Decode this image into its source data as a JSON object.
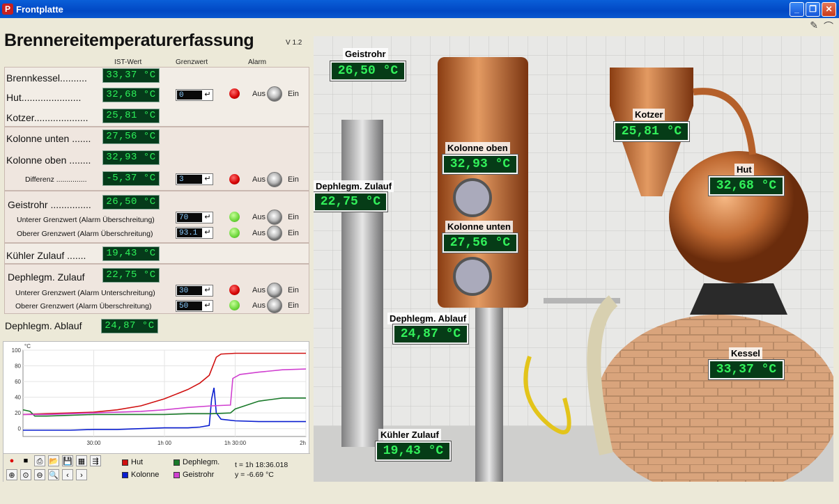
{
  "window": {
    "title": "Frontplatte",
    "app_icon": "app-logo-icon"
  },
  "header": {
    "title": "Brennereitemperaturerfassung",
    "version": "V 1.2"
  },
  "columns": {
    "ist": "IST-Wert",
    "grenz": "Grenzwert",
    "alarm": "Alarm"
  },
  "rows": {
    "brennkessel": {
      "label": "Brennkessel..........",
      "value": "33,37 °C"
    },
    "hut": {
      "label": "Hut......................",
      "value": "32,68 °C",
      "limit": "0",
      "led": "red",
      "off": "Aus",
      "on": "Ein"
    },
    "kotzer": {
      "label": "Kotzer....................",
      "value": "25,81 °C"
    },
    "kolonne_unten": {
      "label": "Kolonne unten .......",
      "value": "27,56 °C"
    },
    "kolonne_oben": {
      "label": "Kolonne oben ........",
      "value": "32,93 °C"
    },
    "differenz": {
      "label": "Differenz ...............",
      "value": "-5,37 °C",
      "limit": "3",
      "led": "red",
      "off": "Aus",
      "on": "Ein"
    },
    "geistrohr": {
      "label": "Geistrohr ...............",
      "value": "26,50 °C"
    },
    "geist_unten": {
      "label": "Unterer Grenzwert (Alarm Überschreitung)",
      "limit": "70",
      "led": "green",
      "off": "Aus",
      "on": "Ein"
    },
    "geist_oben": {
      "label": "Oberer Grenzwert (Alarm Überschreitung)",
      "limit": "93.1",
      "led": "green",
      "off": "Aus",
      "on": "Ein"
    },
    "kuehler": {
      "label": "Kühler Zulauf .......",
      "value": "19,43 °C"
    },
    "dephl_zulauf": {
      "label": "Dephlegm. Zulauf",
      "value": "22,75 °C"
    },
    "dephl_unten": {
      "label": "Unterer Grenzwert (Alarm Unterschreitung)",
      "limit": "30",
      "led": "red",
      "off": "Aus",
      "on": "Ein"
    },
    "dephl_oben": {
      "label": "Oberer Grenzwert (Alarm Überschreitung)",
      "limit": "50",
      "led": "green",
      "off": "Aus",
      "on": "Ein"
    },
    "dephl_ablauf": {
      "label": "Dephlegm. Ablauf",
      "value": "24,87 °C"
    }
  },
  "chart_data": {
    "type": "line",
    "ylabel": "°C",
    "ylim": [
      -10,
      100
    ],
    "yticks": [
      "100",
      "80",
      "60",
      "40",
      "20",
      "0"
    ],
    "xlim": [
      0,
      120
    ],
    "xticks": [
      "30:00",
      "1h 00",
      "1h 30:00",
      "2h"
    ],
    "series": [
      {
        "name": "Hut",
        "color": "#d01010",
        "points": [
          [
            0,
            18
          ],
          [
            10,
            19
          ],
          [
            20,
            20
          ],
          [
            30,
            21
          ],
          [
            40,
            24
          ],
          [
            50,
            29
          ],
          [
            60,
            38
          ],
          [
            70,
            50
          ],
          [
            75,
            58
          ],
          [
            79,
            68
          ],
          [
            82,
            91
          ],
          [
            84,
            95
          ],
          [
            90,
            96
          ],
          [
            100,
            96
          ],
          [
            110,
            96
          ],
          [
            120,
            96
          ]
        ]
      },
      {
        "name": "Kolonne",
        "color": "#0a1ed0",
        "points": [
          [
            0,
            -2
          ],
          [
            10,
            -2
          ],
          [
            20,
            -2
          ],
          [
            30,
            -1
          ],
          [
            40,
            -1
          ],
          [
            50,
            0
          ],
          [
            60,
            1
          ],
          [
            70,
            1
          ],
          [
            75,
            2
          ],
          [
            79,
            4
          ],
          [
            80,
            38
          ],
          [
            81,
            52
          ],
          [
            82,
            20
          ],
          [
            84,
            12
          ],
          [
            90,
            10
          ],
          [
            100,
            9
          ],
          [
            110,
            9
          ],
          [
            120,
            9
          ]
        ]
      },
      {
        "name": "Dephlegm.",
        "color": "#1a7a2a",
        "points": [
          [
            0,
            24
          ],
          [
            3,
            22
          ],
          [
            5,
            16
          ],
          [
            10,
            16
          ],
          [
            20,
            17
          ],
          [
            30,
            18
          ],
          [
            40,
            18
          ],
          [
            50,
            18
          ],
          [
            60,
            18
          ],
          [
            70,
            19
          ],
          [
            80,
            19
          ],
          [
            88,
            20
          ],
          [
            90,
            25
          ],
          [
            95,
            30
          ],
          [
            100,
            35
          ],
          [
            105,
            37
          ],
          [
            110,
            39
          ],
          [
            115,
            39
          ],
          [
            120,
            39
          ]
        ]
      },
      {
        "name": "Geistrohr",
        "color": "#d040d0",
        "points": [
          [
            0,
            18
          ],
          [
            10,
            18
          ],
          [
            20,
            19
          ],
          [
            30,
            20
          ],
          [
            40,
            21
          ],
          [
            50,
            22
          ],
          [
            60,
            24
          ],
          [
            70,
            27
          ],
          [
            80,
            29
          ],
          [
            88,
            30
          ],
          [
            89,
            64
          ],
          [
            92,
            69
          ],
          [
            100,
            72
          ],
          [
            110,
            75
          ],
          [
            120,
            76
          ]
        ]
      }
    ]
  },
  "chart_footer": {
    "t": "t = 1h 18:36.018",
    "y": "y = -6.69 °C"
  },
  "photo_tags": {
    "geistrohr": {
      "label": "Geistrohr",
      "value": "26,50 °C"
    },
    "kotzer": {
      "label": "Kotzer",
      "value": "25,81 °C"
    },
    "kolonne_oben": {
      "label": "Kolonne oben",
      "value": "32,93 °C"
    },
    "hut": {
      "label": "Hut",
      "value": "32,68 °C"
    },
    "dephl_zulauf": {
      "label": "Dephlegm. Zulauf",
      "value": "22,75 °C"
    },
    "kolonne_unten": {
      "label": "Kolonne unten",
      "value": "27,56 °C"
    },
    "dephl_ablauf": {
      "label": "Dephlegm. Ablauf",
      "value": "24,87 °C"
    },
    "kessel": {
      "label": "Kessel",
      "value": "33,37 °C"
    },
    "kuehler": {
      "label": "Kühler Zulauf",
      "value": "19,43 °C"
    }
  }
}
